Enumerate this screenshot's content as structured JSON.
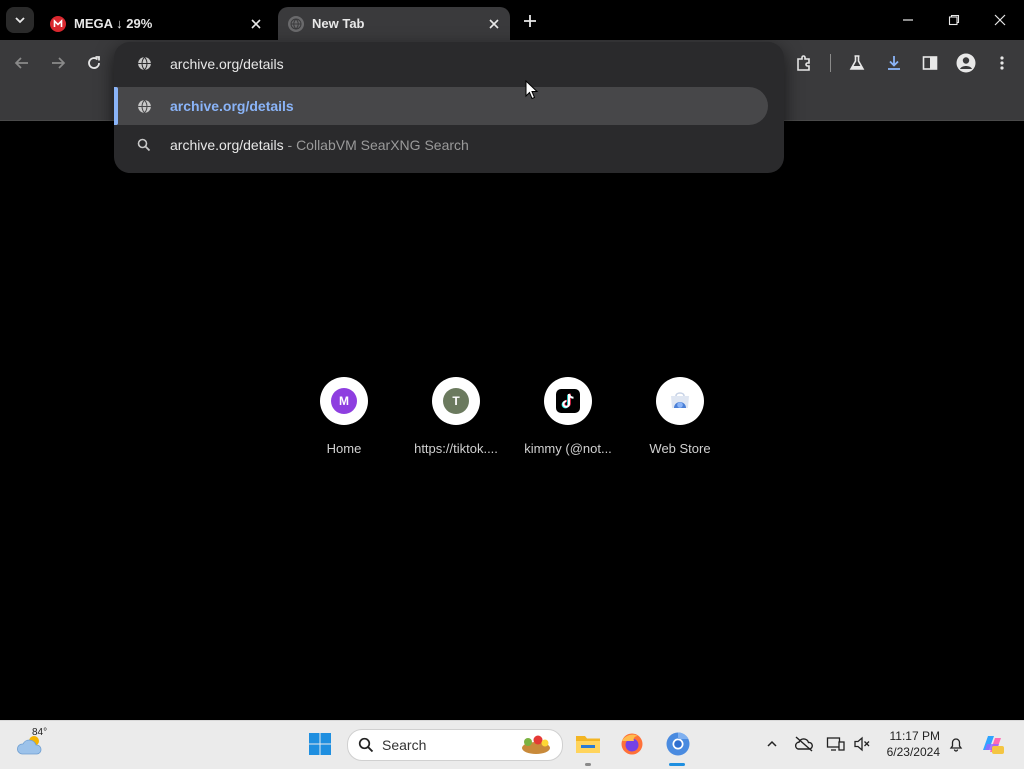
{
  "tabs": [
    {
      "title": "MEGA ↓ 29%",
      "favicon": "mega-icon",
      "active": false
    },
    {
      "title": "New Tab",
      "favicon": "globe-icon",
      "active": true
    }
  ],
  "omnibox": {
    "typed_text": "archive.org/",
    "completed_text": "details",
    "value": "archive.org/details",
    "suggestions": [
      {
        "text": "archive.org/details",
        "suffix": "",
        "icon": "globe-icon",
        "selected": true
      },
      {
        "text": "archive.org/details",
        "suffix": " - CollabVM SearXNG Search",
        "icon": "search-icon",
        "selected": false
      }
    ]
  },
  "shortcuts": [
    {
      "label": "Home",
      "letter": "M",
      "color": "#8e3ee0"
    },
    {
      "label": "https://tiktok....",
      "letter": "T",
      "color": "#6b7a5e"
    },
    {
      "label": "kimmy (@not...",
      "letter": "",
      "color": "#000000"
    },
    {
      "label": "Web Store",
      "letter": "",
      "color": "#4a7fd6"
    }
  ],
  "taskbar": {
    "weather_temp": "84°",
    "search_placeholder": "Search",
    "time": "11:17 PM",
    "date": "6/23/2024"
  },
  "colors": {
    "accent": "#8ab4f8",
    "toolbar": "#3a3a3c",
    "dropdown": "#2a2a2c",
    "taskbar": "#ebebeb"
  }
}
